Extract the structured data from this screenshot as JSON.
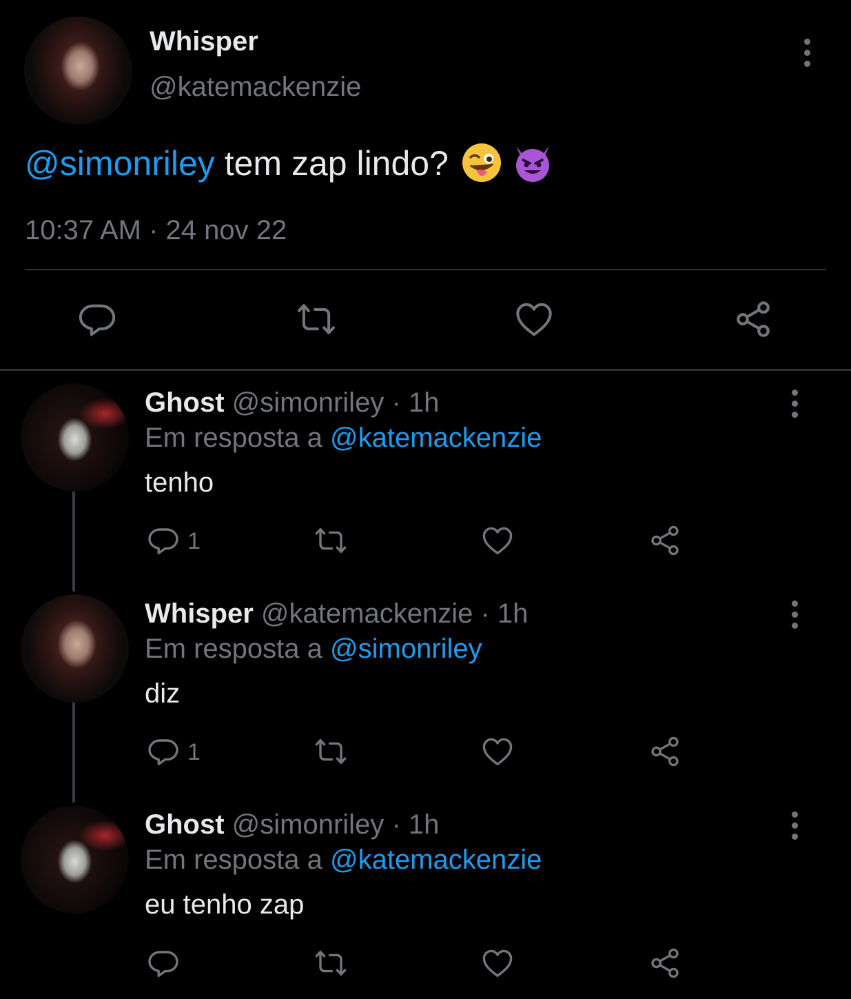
{
  "main_tweet": {
    "display_name": "Whisper",
    "handle": "@katemackenzie",
    "mention": "@simonriley",
    "text": "tem zap lindo?",
    "timestamp": "10:37 AM · 24 nov 22",
    "emojis": [
      "winking-face-with-tongue",
      "smiling-face-with-horns"
    ]
  },
  "replies": [
    {
      "display_name": "Ghost",
      "handle": "@simonriley",
      "time": "· 1h",
      "reply_prefix": "Em resposta a",
      "reply_to": "@katemackenzie",
      "text": "tenho",
      "reply_count": "1"
    },
    {
      "display_name": "Whisper",
      "handle": "@katemackenzie",
      "time": "· 1h",
      "reply_prefix": "Em resposta a",
      "reply_to": "@simonriley",
      "text": "diz",
      "reply_count": "1"
    },
    {
      "display_name": "Ghost",
      "handle": "@simonriley",
      "time": "· 1h",
      "reply_prefix": "Em resposta a",
      "reply_to": "@katemackenzie",
      "text": "eu tenho zap",
      "reply_count": ""
    }
  ],
  "colors": {
    "background": "#000000",
    "text": "#e7e9ea",
    "muted": "#71767b",
    "link": "#1d9bf0"
  }
}
